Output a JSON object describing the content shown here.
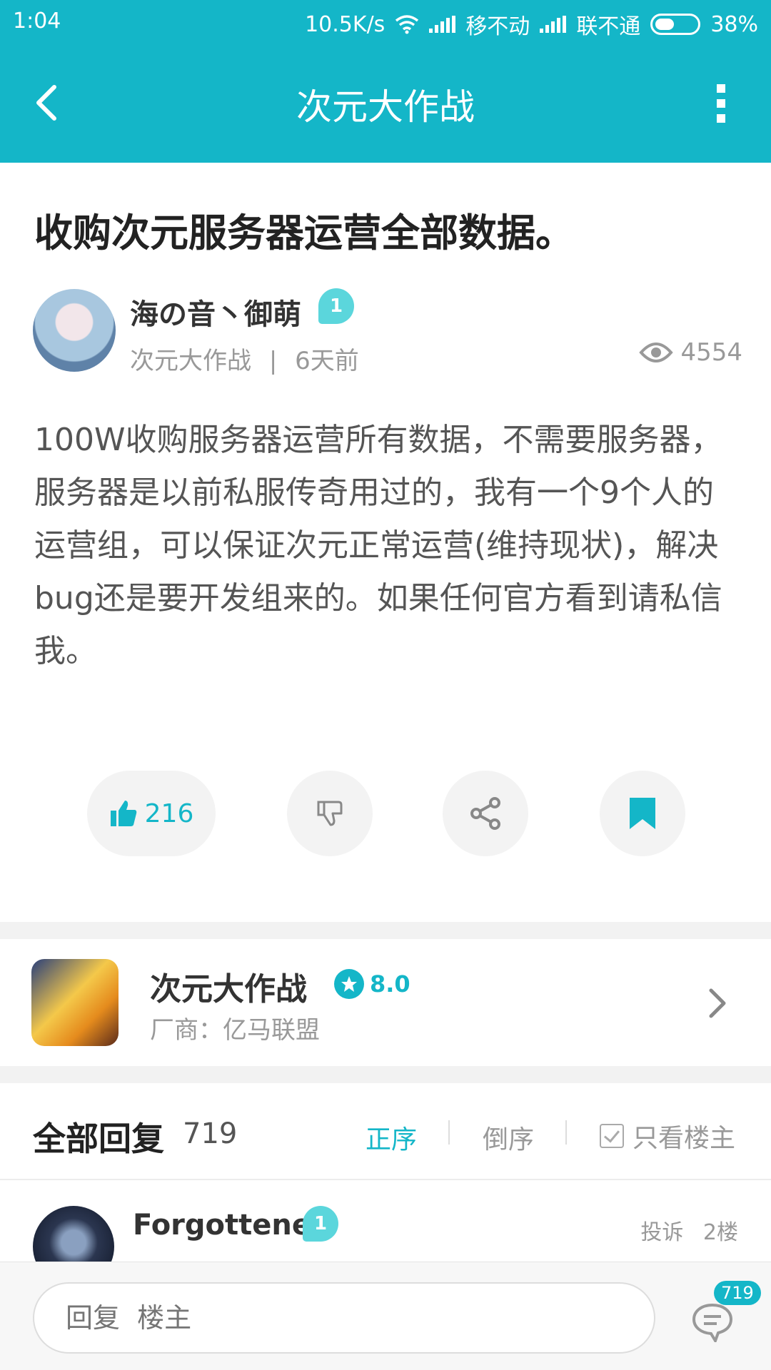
{
  "status_bar": {
    "time": "1:04",
    "net_speed": "10.5K/s",
    "carrier1": "移不动",
    "carrier2": "联不通",
    "battery": "38%"
  },
  "app_bar": {
    "title": "次元大作战",
    "back_icon": "chevron-left-icon",
    "more_icon": "more-vertical-icon"
  },
  "post": {
    "title": "收购次元服务器运营全部数据。",
    "author": "海の音丶御萌",
    "author_level": "1",
    "forum": "次元大作战",
    "time_ago": "6天前",
    "meta_sep": "|",
    "views": "4554",
    "body": "100W收购服务器运营所有数据，不需要服务器，服务器是以前私服传奇用过的，我有一个9个人的运营组，可以保证次元正常运营(维持现状)，解决bug还是要开发组来的。如果任何官方看到请私信我。",
    "likes": "216"
  },
  "game_card": {
    "name": "次元大作战",
    "rating": "8.0",
    "vendor": "厂商：亿马联盟"
  },
  "replies": {
    "title": "全部回复",
    "count": "719",
    "sort_asc": "正序",
    "sort_desc": "倒序",
    "op_only": "只看楼主"
  },
  "first_reply": {
    "author": "Forgottener",
    "level": "1",
    "report": "投诉",
    "floor": "2楼"
  },
  "bottom_bar": {
    "placeholder": "回复  楼主",
    "comment_count": "719"
  },
  "colors": {
    "accent": "#14b6c8",
    "level_badge": "#5bd6dc"
  }
}
